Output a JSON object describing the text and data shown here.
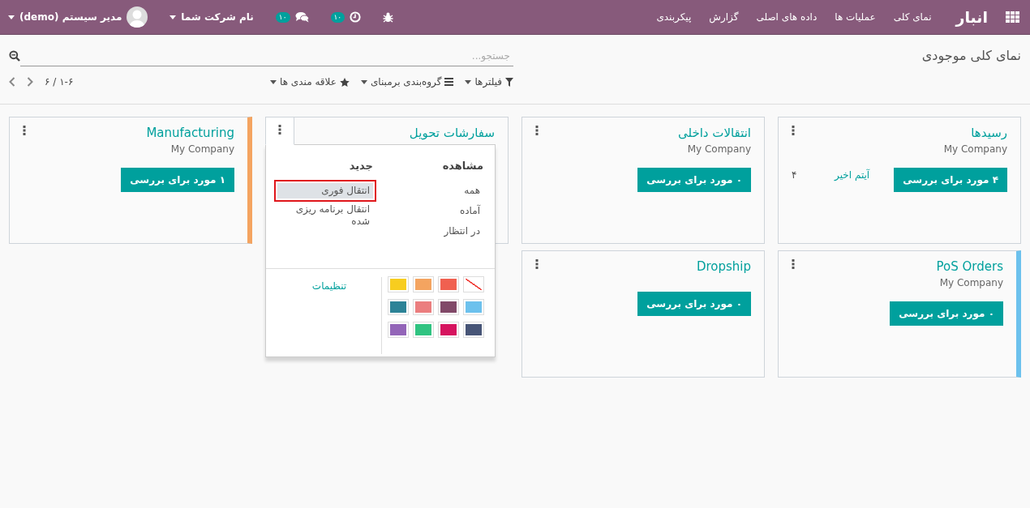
{
  "navbar": {
    "app_name": "انبار",
    "menu": [
      "نمای کلی",
      "عملیات ها",
      "داده های اصلی",
      "گزارش",
      "پیکربندی"
    ],
    "systray": [
      {
        "kind": "bug"
      },
      {
        "kind": "activity",
        "badge": "۱۰"
      },
      {
        "kind": "messages",
        "badge": "۱۰"
      },
      {
        "kind": "company",
        "label": "نام شرکت شما"
      },
      {
        "kind": "user",
        "label": "مدیر سیستم (demo)"
      }
    ]
  },
  "control_panel": {
    "title": "نمای کلی موجودی",
    "search": {
      "placeholder": "جستجو..."
    },
    "filters": [
      {
        "kind": "filter",
        "label": "فیلترها"
      },
      {
        "kind": "groupby",
        "label": "گروه‌بندی برمبنای"
      },
      {
        "kind": "favorites",
        "label": "علاقه مندی ها"
      }
    ],
    "pager": "۱-۶ / ۶"
  },
  "cards": [
    {
      "title": "رسیدها",
      "company": "My Company",
      "button": "۴ مورد برای بررسی",
      "recent": {
        "label": "آیتم اخیر",
        "count": "۴"
      },
      "menu_open": false
    },
    {
      "title": "انتقالات داخلی",
      "company": "My Company",
      "button": "۰ مورد برای بررسی",
      "menu_open": false
    },
    {
      "title": "سفارشات تحویل",
      "menu_open": true,
      "dropdown": {
        "view_title": "مشاهده",
        "view_items": [
          "همه",
          "آماده",
          "در انتظار"
        ],
        "new_title": "جدید",
        "new_items": [
          {
            "label": "انتقال فوری",
            "selected": true
          },
          {
            "label": "انتقال برنامه ریزی شده",
            "selected": false
          }
        ],
        "colors": [
          {
            "kind": "none"
          },
          {
            "kind": "swatch",
            "color": "#f06050"
          },
          {
            "kind": "swatch",
            "color": "#f4a460"
          },
          {
            "kind": "swatch",
            "color": "#f7cd1f"
          },
          {
            "kind": "swatch",
            "color": "#6cc1ed"
          },
          {
            "kind": "swatch",
            "color": "#814968"
          },
          {
            "kind": "swatch",
            "color": "#eb7e7f"
          },
          {
            "kind": "swatch",
            "color": "#2c8397"
          },
          {
            "kind": "swatch",
            "color": "#475577"
          },
          {
            "kind": "swatch",
            "color": "#d6145f"
          },
          {
            "kind": "swatch",
            "color": "#30c381"
          },
          {
            "kind": "swatch",
            "color": "#9365b8"
          }
        ],
        "settings": "تنظیمات"
      }
    },
    {
      "title": "Manufacturing",
      "company": "My Company",
      "button": "۱ مورد برای بررسی",
      "color": "#f4a460",
      "menu_open": false
    },
    {
      "title": "PoS Orders",
      "company": "My Company",
      "button": "۰ مورد برای بررسی",
      "color": "#6cc1ed",
      "menu_open": false
    },
    {
      "title": "Dropship",
      "button": "۰ مورد برای بررسی",
      "menu_open": false
    }
  ]
}
